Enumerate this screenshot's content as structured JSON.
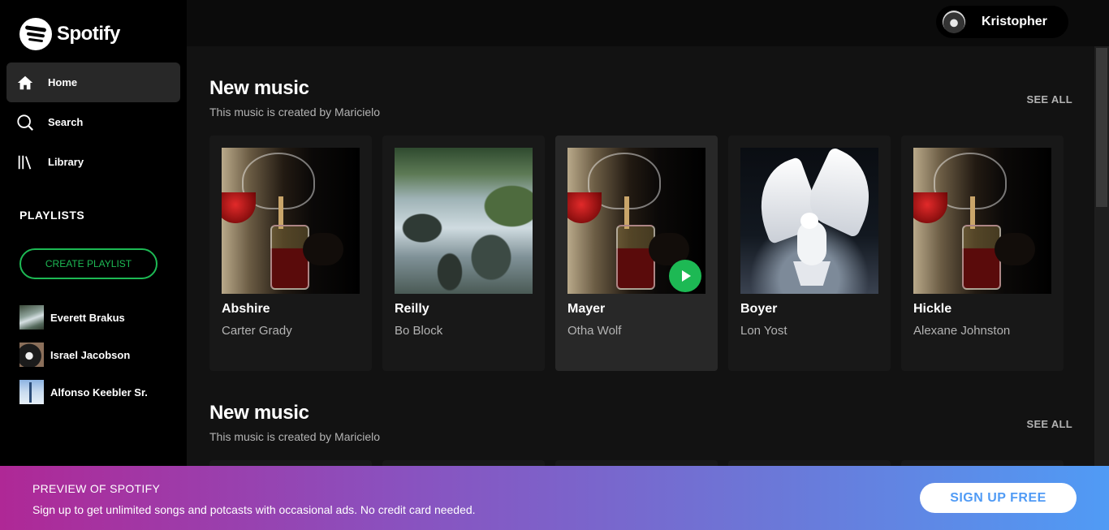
{
  "app": {
    "name": "Spotify"
  },
  "nav": [
    {
      "label": "Home",
      "icon": "home-icon",
      "active": true
    },
    {
      "label": "Search",
      "icon": "search-icon",
      "active": false
    },
    {
      "label": "Library",
      "icon": "library-icon",
      "active": false
    }
  ],
  "playlists": {
    "title": "PLAYLISTS",
    "create_label": "CREATE PLAYLIST",
    "items": [
      {
        "name": "Everett Brakus"
      },
      {
        "name": "Israel Jacobson"
      },
      {
        "name": "Alfonso Keebler Sr."
      }
    ]
  },
  "user": {
    "name": "Kristopher"
  },
  "sections": [
    {
      "title": "New music",
      "subtitle": "This music is created by Maricielo",
      "see_all": "SEE ALL",
      "cards": [
        {
          "title": "Abshire",
          "artist": "Carter Grady"
        },
        {
          "title": "Reilly",
          "artist": "Bo Block"
        },
        {
          "title": "Mayer",
          "artist": "Otha Wolf"
        },
        {
          "title": "Boyer",
          "artist": "Lon Yost"
        },
        {
          "title": "Hickle",
          "artist": "Alexane Johnston"
        }
      ]
    },
    {
      "title": "New music",
      "subtitle": "This music is created by Maricielo",
      "see_all": "SEE ALL"
    }
  ],
  "banner": {
    "title": "PREVIEW OF SPOTIFY",
    "text": "Sign up to get unlimited songs and potcasts with occasional ads. No credit card needed.",
    "signup_label": "SIGN UP FREE"
  },
  "colors": {
    "accent": "#1db954",
    "sidebar_bg": "#000000",
    "main_bg": "#121212",
    "card_bg": "#181818"
  }
}
